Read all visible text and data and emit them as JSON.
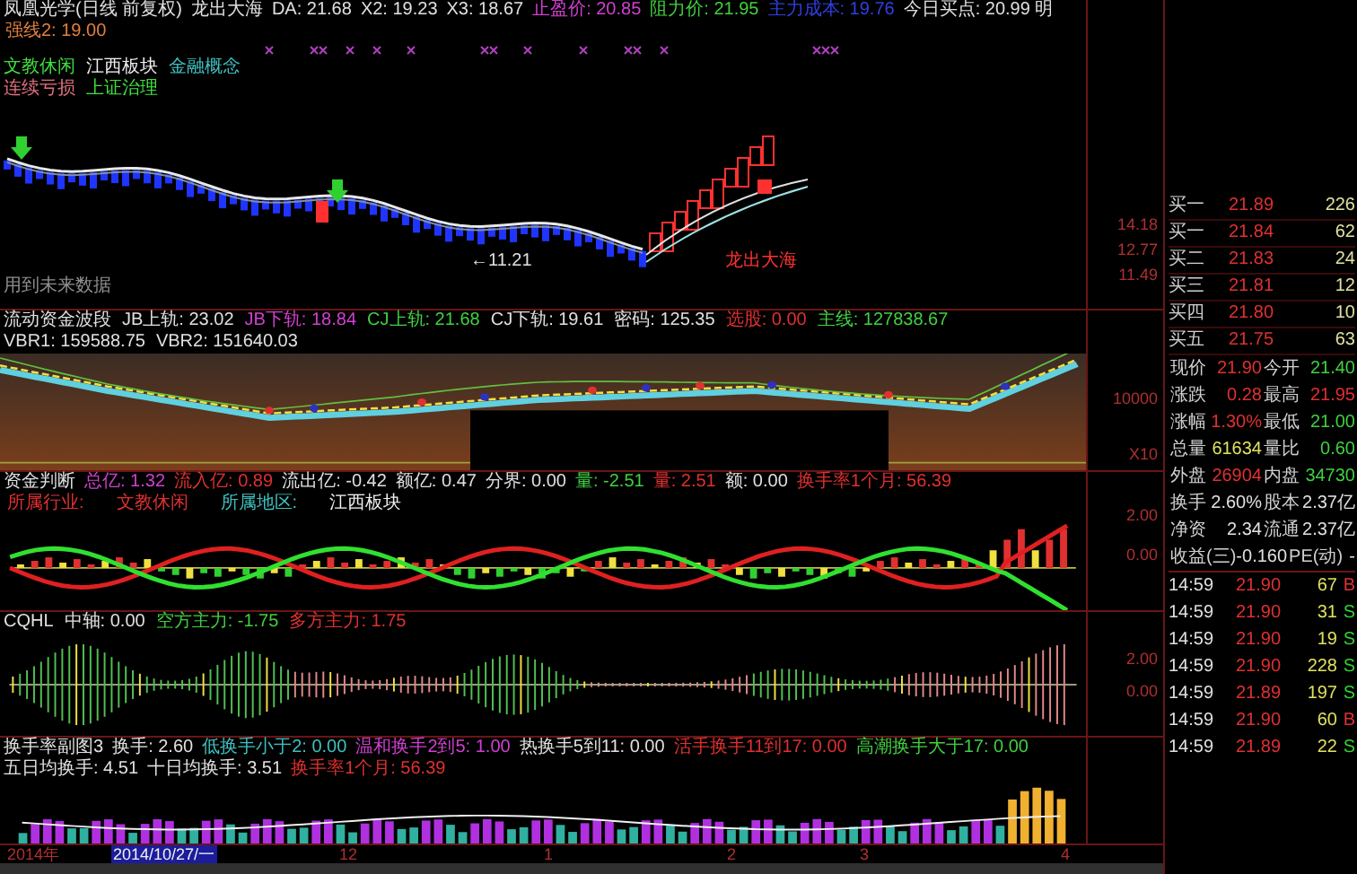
{
  "main_panel": {
    "header": [
      {
        "text": "凤凰光学(日线 前复权)",
        "color": "#e0e0e0"
      },
      {
        "text": "龙出大海",
        "color": "#e0e0e0"
      },
      {
        "text": "DA: 21.68",
        "color": "#e0e0e0"
      },
      {
        "text": "X2: 19.23",
        "color": "#e0e0e0"
      },
      {
        "text": "X3: 18.67",
        "color": "#e0e0e0"
      },
      {
        "text": "止盈价: 20.85",
        "color": "#d040d0"
      },
      {
        "text": "阻力价: 21.95",
        "color": "#40d040"
      },
      {
        "text": "主力成本: 19.76",
        "color": "#3040e0"
      },
      {
        "text": "今日买点: 20.99 明",
        "color": "#e0e0e0"
      }
    ],
    "level_line": {
      "text": "强线2: 19.00",
      "color": "#e08040"
    },
    "tags": [
      {
        "text": "文教休闲",
        "color": "#40e040"
      },
      {
        "text": "江西板块",
        "color": "#f0f0f0"
      },
      {
        "text": "金融概念",
        "color": "#40c0c0"
      },
      {
        "text": "连续亏损",
        "color": "#e07080"
      },
      {
        "text": "上证治理",
        "color": "#40e040"
      }
    ],
    "low_label": "←11.21",
    "signal_label": "龙出大海",
    "note": "用到未来数据",
    "axis": [
      "14.18",
      "12.77",
      "11.49"
    ]
  },
  "fund_wave_panel": {
    "header": [
      {
        "text": "流动资金波段",
        "color": "#e0e0e0"
      },
      {
        "text": "JB上轨: 23.02",
        "color": "#e0e0e0"
      },
      {
        "text": "JB下轨: 18.84",
        "color": "#d040d0"
      },
      {
        "text": "CJ上轨: 21.68",
        "color": "#40d040"
      },
      {
        "text": "CJ下轨: 19.61",
        "color": "#e0e0e0"
      },
      {
        "text": "密码: 125.35",
        "color": "#e0e0e0"
      },
      {
        "text": "选股: 0.00",
        "color": "#e03030"
      },
      {
        "text": "主线: 127838.67",
        "color": "#40d040"
      },
      {
        "text": "VBR1: 159588.75",
        "color": "#e0e0e0"
      },
      {
        "text": "VBR2: 151640.03",
        "color": "#e0e0e0"
      }
    ],
    "axis": [
      "10000",
      "X10"
    ]
  },
  "fund_judge_panel": {
    "header": [
      {
        "text": "资金判断",
        "color": "#e0e0e0"
      },
      {
        "text": "总亿: 1.32",
        "color": "#d040d0"
      },
      {
        "text": "流入亿: 0.89",
        "color": "#e03030"
      },
      {
        "text": "流出亿: -0.42",
        "color": "#e0e0e0"
      },
      {
        "text": "额亿: 0.47",
        "color": "#e0e0e0"
      },
      {
        "text": "分界: 0.00",
        "color": "#e0e0e0"
      },
      {
        "text": "量: -2.51",
        "color": "#40d040"
      },
      {
        "text": "量: 2.51",
        "color": "#e03030"
      },
      {
        "text": "额: 0.00",
        "color": "#e0e0e0"
      },
      {
        "text": "换手率1个月: 56.39",
        "color": "#e03030"
      }
    ],
    "info": [
      {
        "text": "所属行业:",
        "color": "#e03030"
      },
      {
        "text": "文教休闲",
        "color": "#e03030"
      },
      {
        "text": "所属地区:",
        "color": "#40c0c0"
      },
      {
        "text": "江西板块",
        "color": "#f0f0f0"
      }
    ],
    "axis": [
      "2.00",
      "0.00"
    ]
  },
  "cqhl_panel": {
    "header": [
      {
        "text": "CQHL",
        "color": "#e0e0e0"
      },
      {
        "text": "中轴: 0.00",
        "color": "#e0e0e0"
      },
      {
        "text": "空方主力: -1.75",
        "color": "#40d040"
      },
      {
        "text": "多方主力: 1.75",
        "color": "#e03030"
      }
    ],
    "axis": [
      "2.00",
      "0.00"
    ]
  },
  "turnover_panel": {
    "header": [
      {
        "text": "换手率副图3",
        "color": "#e0e0e0"
      },
      {
        "text": "换手: 2.60",
        "color": "#e0e0e0"
      },
      {
        "text": "低换手小于2: 0.00",
        "color": "#40c0c0"
      },
      {
        "text": "温和换手2到5: 1.00",
        "color": "#d040d0"
      },
      {
        "text": "热换手5到11: 0.00",
        "color": "#e0e0e0"
      },
      {
        "text": "活手换手11到17: 0.00",
        "color": "#e03030"
      },
      {
        "text": "高潮换手大于17: 0.00",
        "color": "#40d040"
      },
      {
        "text": "五日均换手: 4.51",
        "color": "#e0e0e0"
      },
      {
        "text": "十日均换手: 3.51",
        "color": "#e0e0e0"
      },
      {
        "text": "换手率1个月: 56.39",
        "color": "#e03030"
      }
    ]
  },
  "date_axis": [
    {
      "text": "2014年",
      "highlighted": false
    },
    {
      "text": "2014/10/27/一",
      "highlighted": true
    },
    {
      "text": "12",
      "highlighted": false
    },
    {
      "text": "1",
      "highlighted": false
    },
    {
      "text": "2",
      "highlighted": false
    },
    {
      "text": "3",
      "highlighted": false
    },
    {
      "text": "4",
      "highlighted": false
    }
  ],
  "quote": {
    "order_book": [
      {
        "label": "买一",
        "price": "21.89",
        "volume": "226"
      },
      {
        "label": "买一",
        "price": "21.84",
        "volume": "62"
      },
      {
        "label": "买二",
        "price": "21.83",
        "volume": "24"
      },
      {
        "label": "买三",
        "price": "21.81",
        "volume": "12"
      },
      {
        "label": "买四",
        "price": "21.80",
        "volume": "10"
      },
      {
        "label": "买五",
        "price": "21.75",
        "volume": "63"
      }
    ],
    "stats": [
      {
        "cells": [
          {
            "label": "现价",
            "value": "21.90",
            "color": "#e03030"
          },
          {
            "label": "今开",
            "value": "21.40",
            "color": "#40d040"
          }
        ]
      },
      {
        "cells": [
          {
            "label": "涨跌",
            "value": "0.28",
            "color": "#e03030"
          },
          {
            "label": "最高",
            "value": "21.95",
            "color": "#e03030"
          }
        ]
      },
      {
        "cells": [
          {
            "label": "涨幅",
            "value": "1.30%",
            "color": "#e03030"
          },
          {
            "label": "最低",
            "value": "21.00",
            "color": "#40d040"
          }
        ]
      },
      {
        "cells": [
          {
            "label": "总量",
            "value": "61634",
            "color": "#e0e060"
          },
          {
            "label": "量比",
            "value": "0.60",
            "color": "#40d040"
          }
        ]
      },
      {
        "cells": [
          {
            "label": "外盘",
            "value": "26904",
            "color": "#e03030"
          },
          {
            "label": "内盘",
            "value": "34730",
            "color": "#40d040"
          }
        ]
      },
      {
        "cells": [
          {
            "label": "换手",
            "value": "2.60%",
            "color": "#e0e0e0"
          },
          {
            "label": "股本",
            "value": "2.37亿",
            "color": "#e0e0e0"
          }
        ]
      },
      {
        "cells": [
          {
            "label": "净资",
            "value": "2.34",
            "color": "#e0e0e0"
          },
          {
            "label": "流通",
            "value": "2.37亿",
            "color": "#e0e0e0"
          }
        ]
      },
      {
        "cells": [
          {
            "label": "收益(三)",
            "value": "-0.160",
            "color": "#e0e0e0"
          },
          {
            "label": "PE(动)",
            "value": "-",
            "color": "#e0e0e0"
          }
        ]
      }
    ],
    "ticks": [
      {
        "time": "14:59",
        "price": "21.90",
        "volume": "67",
        "side": "B",
        "kind": "buy"
      },
      {
        "time": "14:59",
        "price": "21.90",
        "volume": "31",
        "side": "S",
        "kind": "sell"
      },
      {
        "time": "14:59",
        "price": "21.90",
        "volume": "19",
        "side": "S",
        "kind": "sell"
      },
      {
        "time": "14:59",
        "price": "21.90",
        "volume": "228",
        "side": "S",
        "kind": "sell"
      },
      {
        "time": "14:59",
        "price": "21.89",
        "volume": "197",
        "side": "S",
        "kind": "sell"
      },
      {
        "time": "14:59",
        "price": "21.90",
        "volume": "60",
        "side": "B",
        "kind": "buy"
      },
      {
        "time": "14:59",
        "price": "21.89",
        "volume": "22",
        "side": "S",
        "kind": "sell"
      }
    ]
  }
}
